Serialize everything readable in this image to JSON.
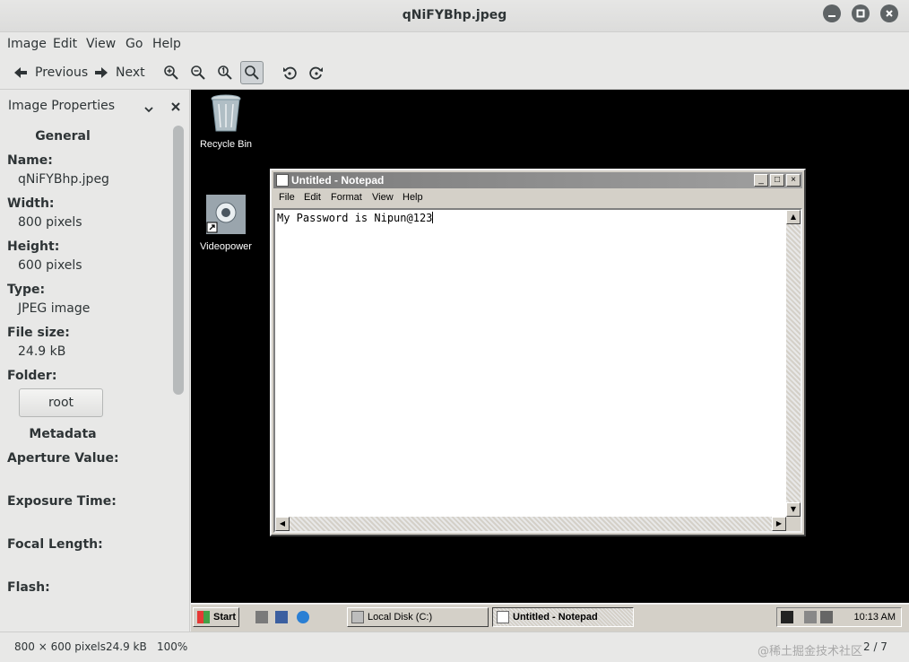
{
  "window": {
    "title": "qNiFYBhp.jpeg"
  },
  "menu": [
    "Image",
    "Edit",
    "View",
    "Go",
    "Help"
  ],
  "toolbar": {
    "previous_label": "Previous",
    "next_label": "Next"
  },
  "sidebar": {
    "title": "Image Properties",
    "general_heading": "General",
    "name_label": "Name:",
    "name_value": "qNiFYBhp.jpeg",
    "width_label": "Width:",
    "width_value": "800 pixels",
    "height_label": "Height:",
    "height_value": "600 pixels",
    "type_label": "Type:",
    "type_value": "JPEG image",
    "filesize_label": "File size:",
    "filesize_value": "24.9 kB",
    "folder_label": "Folder:",
    "folder_button": "root",
    "metadata_heading": "Metadata",
    "aperture_label": "Aperture Value:",
    "exposure_label": "Exposure Time:",
    "focal_label": "Focal Length:",
    "flash_label": "Flash:"
  },
  "screenshot": {
    "desktop_icons": {
      "recycle_bin": "Recycle Bin",
      "videopower": "Videopower"
    },
    "notepad": {
      "title": "Untitled - Notepad",
      "menu": [
        "File",
        "Edit",
        "Format",
        "View",
        "Help"
      ],
      "content": "My Password is Nipun@123"
    },
    "taskbar": {
      "start": "Start",
      "tasks": [
        "Local Disk (C:)",
        "Untitled - Notepad"
      ],
      "time": "10:13 AM"
    }
  },
  "statusbar": {
    "dimensions": "800 × 600 pixels",
    "size": "24.9 kB",
    "zoom": "100%",
    "position": "2 / 7"
  },
  "watermark": "@稀土掘金技术社区"
}
